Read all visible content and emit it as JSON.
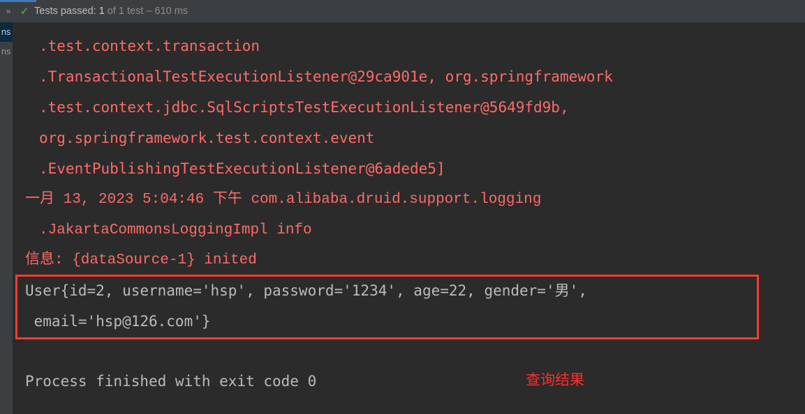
{
  "topbar": {
    "expand_icon": "chevron-double-right-icon",
    "status_icon": "green-check-icon",
    "status_prefix": "Tests passed: ",
    "status_count": "1",
    "status_suffix": " of 1 test – 610 ms",
    "progress_color": "#3d7ab8",
    "check_color": "#499c54"
  },
  "sidebar": {
    "items": [
      {
        "label": "ns",
        "selected": true
      },
      {
        "label": "ns",
        "selected": false
      }
    ]
  },
  "console": {
    "error_color": "#ff6b68",
    "stdout_color": "#bbbbbb",
    "annotation_color": "#ff2d2d",
    "lines": [
      {
        "text": ".test.context.transaction",
        "stream": "stderr"
      },
      {
        "text": ".TransactionalTestExecutionListener@29ca901e, org.springframework",
        "stream": "stderr"
      },
      {
        "text": ".test.context.jdbc.SqlScriptsTestExecutionListener@5649fd9b,",
        "stream": "stderr"
      },
      {
        "text": "org.springframework.test.context.event",
        "stream": "stderr"
      },
      {
        "text": ".EventPublishingTestExecutionListener@6adede5]",
        "stream": "stderr"
      },
      {
        "text": "一月 13, 2023 5:04:46 下午 com.alibaba.druid.support.logging",
        "stream": "stderr"
      },
      {
        "text": ".JakartaCommonsLoggingImpl info",
        "stream": "stderr"
      },
      {
        "text": "信息: {dataSource-1} inited",
        "stream": "stderr"
      },
      {
        "text": "User{id=2, username='hsp', password='1234', age=22, gender='男',",
        "stream": "stdout"
      },
      {
        "text": " email='hsp@126.com'}",
        "stream": "stdout"
      },
      {
        "text": "Process finished with exit code 0",
        "stream": "stdout"
      }
    ],
    "annotation": "查询结果"
  }
}
